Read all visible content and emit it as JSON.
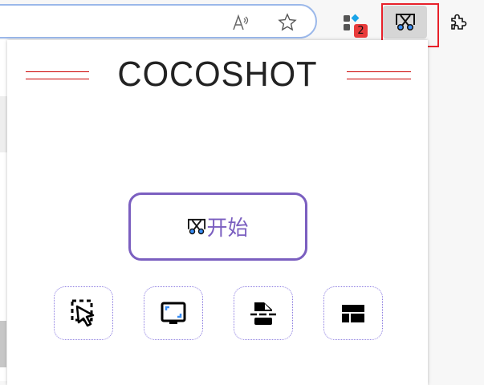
{
  "browser": {
    "toolbar_icons": [
      "read-aloud-icon",
      "favorite-star-icon",
      "extensions-collection-icon",
      "cocoshot-extension-icon",
      "extensions-puzzle-icon"
    ],
    "badge_count": "2",
    "highlight_color": "#e8202a"
  },
  "popup": {
    "title": "COCOSHOT",
    "start_label": "开始",
    "accent_color": "#7b5fc0",
    "tools": [
      {
        "icon": "region-select-cursor-icon"
      },
      {
        "icon": "fullscreen-monitor-icon"
      },
      {
        "icon": "scroll-capture-document-icon"
      },
      {
        "icon": "layout-panels-icon"
      }
    ]
  }
}
